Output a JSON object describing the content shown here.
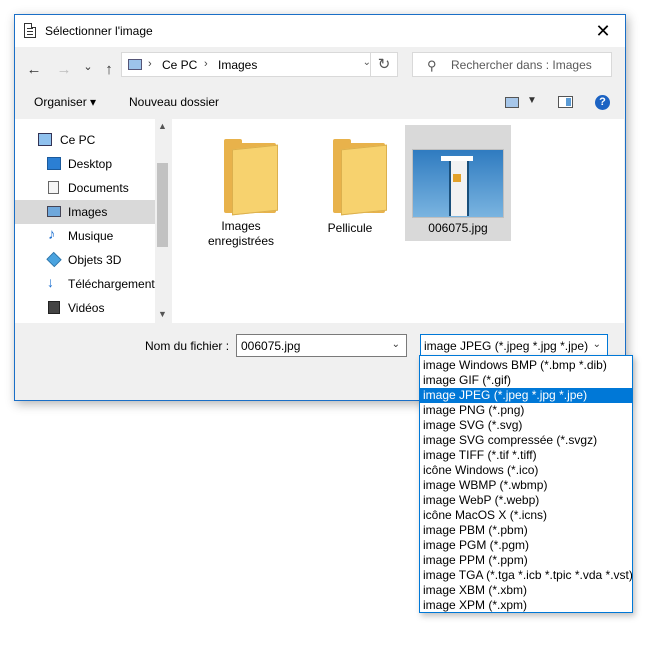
{
  "window": {
    "title": "Sélectionner l'image",
    "close_glyph": "✕",
    "accent_color": "#0078d7"
  },
  "nav": {
    "back_glyph": "←",
    "forward_glyph": "→",
    "recent_glyph": "⌄",
    "up_glyph": "↑",
    "breadcrumb": [
      "Ce PC",
      "Images"
    ],
    "sep_glyph": "›",
    "drop_glyph": "⌄",
    "refresh_glyph": "↻",
    "search_placeholder": "Rechercher dans : Images",
    "search_icon": "search-icon"
  },
  "toolbar": {
    "organize_label": "Organiser ▾",
    "new_folder_label": "Nouveau dossier",
    "view_drop": "▼",
    "help_glyph": "?"
  },
  "sidebar": {
    "items": [
      {
        "label": "Ce PC",
        "icon": "computer-icon"
      },
      {
        "label": "Desktop",
        "icon": "desktop-icon"
      },
      {
        "label": "Documents",
        "icon": "documents-icon"
      },
      {
        "label": "Images",
        "icon": "pictures-icon",
        "selected": true
      },
      {
        "label": "Musique",
        "icon": "music-icon"
      },
      {
        "label": "Objets 3D",
        "icon": "objects-3d-icon"
      },
      {
        "label": "Téléchargements",
        "icon": "downloads-icon"
      },
      {
        "label": "Vidéos",
        "icon": "videos-icon"
      }
    ],
    "scroll_up": "▲",
    "scroll_down": "▼"
  },
  "files": [
    {
      "name_line1": "Images",
      "name_line2": "enregistrées",
      "type": "folder"
    },
    {
      "name_line1": "Pellicule",
      "name_line2": "",
      "type": "folder"
    },
    {
      "name_line1": "006075.jpg",
      "name_line2": "",
      "type": "image",
      "selected": true
    }
  ],
  "filename": {
    "label": "Nom du fichier :",
    "value": "006075.jpg",
    "drop": "⌄"
  },
  "filetype": {
    "value": "image JPEG (*.jpeg *.jpg *.jpe)",
    "drop": "⌄",
    "options": [
      "image Windows BMP (*.bmp *.dib)",
      "image GIF (*.gif)",
      "image JPEG (*.jpeg *.jpg *.jpe)",
      "image PNG (*.png)",
      "image SVG (*.svg)",
      "image SVG compressée (*.svgz)",
      "image TIFF (*.tif *.tiff)",
      "icône Windows (*.ico)",
      "image WBMP (*.wbmp)",
      "image WebP (*.webp)",
      "icône MacOS X (*.icns)",
      "image PBM (*.pbm)",
      "image PGM (*.pgm)",
      "image PPM (*.ppm)",
      "image TGA (*.tga *.icb *.tpic *.vda *.vst)",
      "image XBM (*.xbm)",
      "image XPM (*.xpm)"
    ],
    "selected_index": 2
  }
}
